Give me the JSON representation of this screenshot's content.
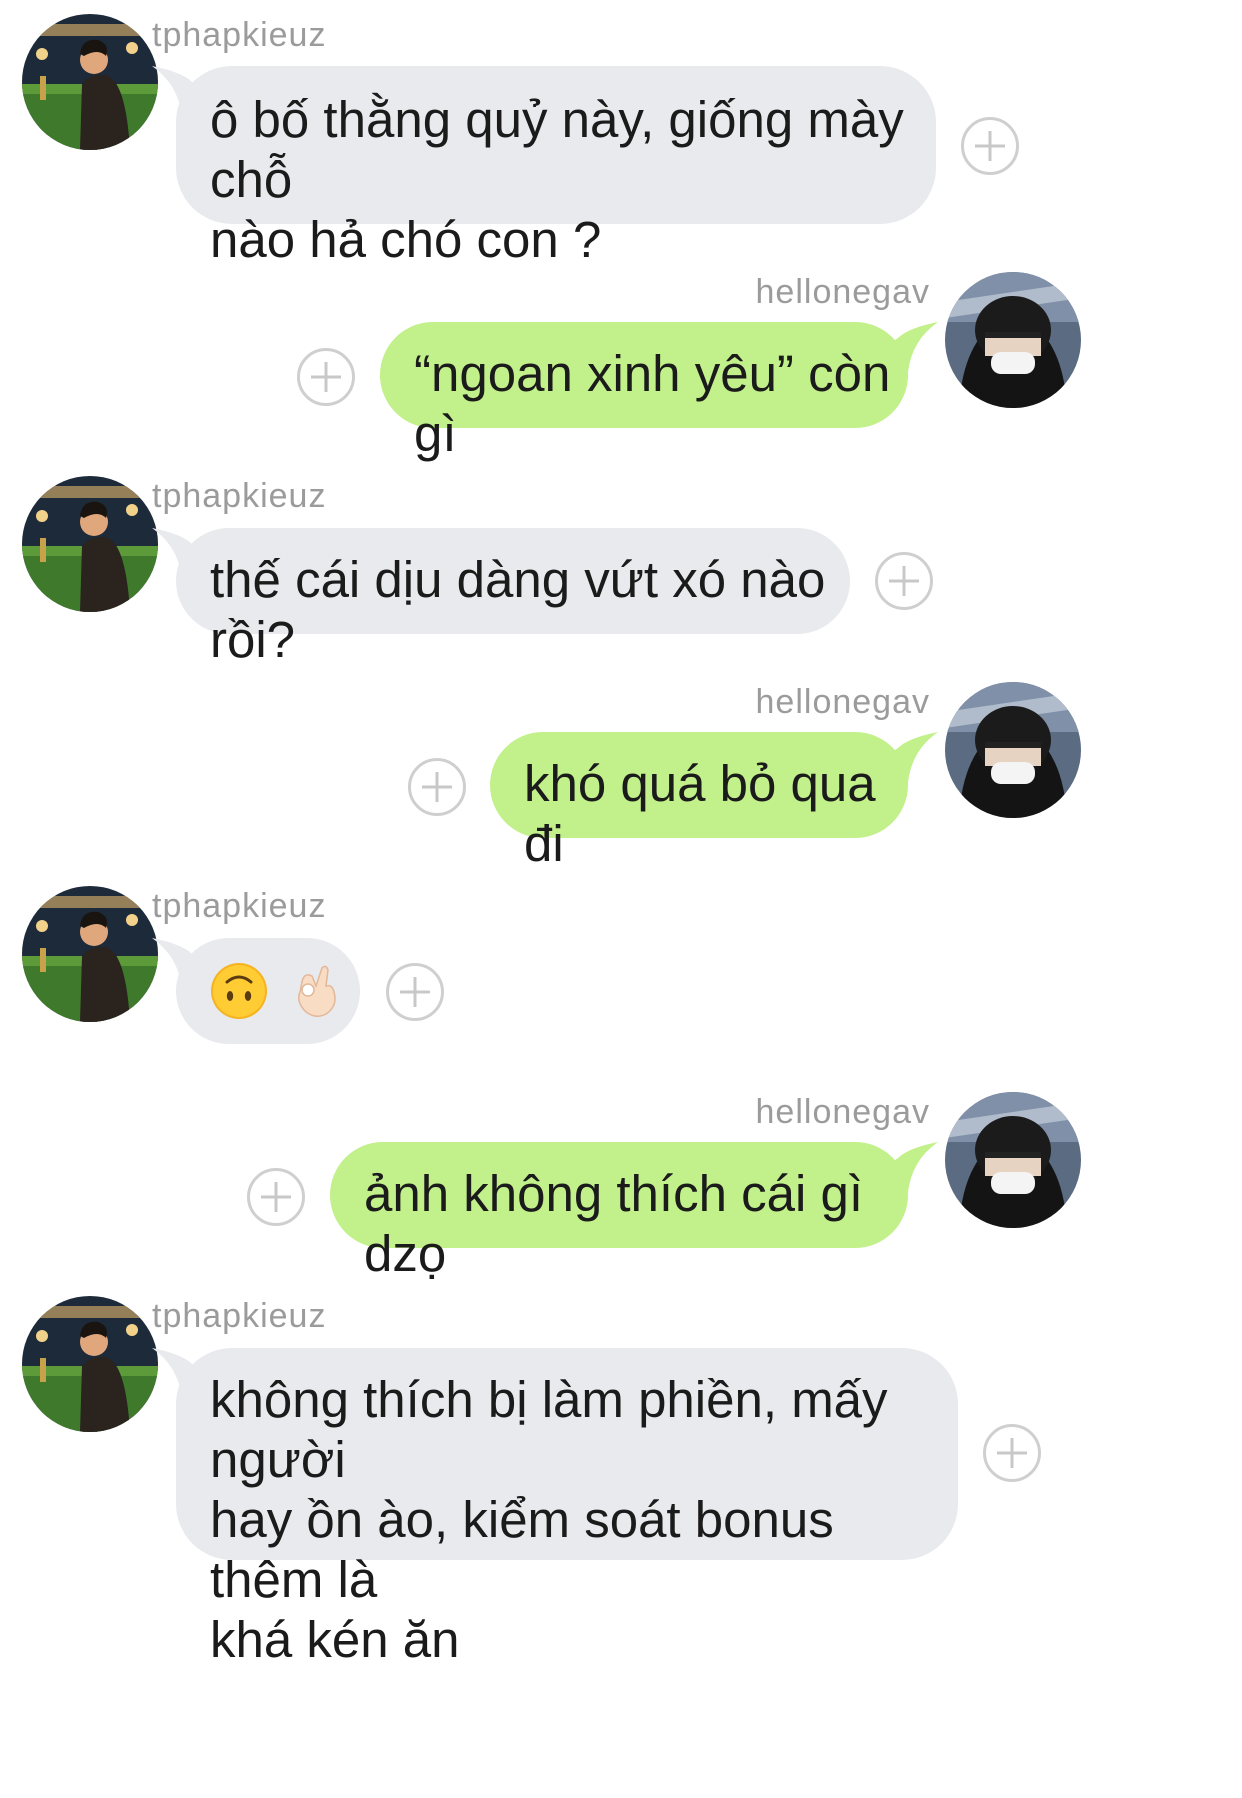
{
  "chat": {
    "messages": [
      {
        "sender": "tphapkieuz",
        "text": "ô bố thằng quỷ này, giống mày chỗ\nnào hả chó con ?"
      },
      {
        "sender": "hellonegav",
        "text": "“ngoan xinh yêu” còn gì"
      },
      {
        "sender": "tphapkieuz",
        "text": "thế cái dịu dàng vứt xó nào rồi?"
      },
      {
        "sender": "hellonegav",
        "text": "khó quá bỏ qua đi"
      },
      {
        "sender": "tphapkieuz",
        "emojis": [
          "upside-down-face-emoji",
          "ok-hand-emoji"
        ]
      },
      {
        "sender": "hellonegav",
        "text": "ảnh không thích cái gì dzọ"
      },
      {
        "sender": "tphapkieuz",
        "text": "không thích bị làm phiền, mấy người\nhay ồn ào, kiểm soát bonus thêm là\nkhá kén ăn"
      }
    ],
    "colors": {
      "incoming_bubble": "#e9eaed",
      "outgoing_bubble": "#c2f08a",
      "username": "#9b9b9b"
    },
    "icons": [
      "add-reaction-icon",
      "avatar-tphapkieuz",
      "avatar-hellonegav"
    ]
  }
}
